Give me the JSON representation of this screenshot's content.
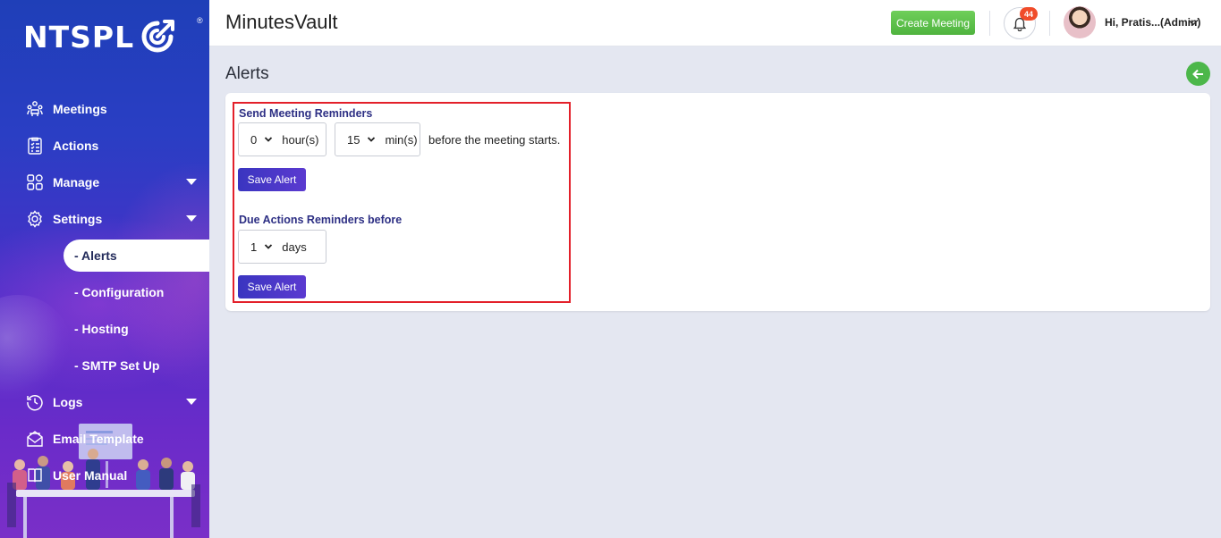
{
  "brand": {
    "logo_text": "NTSPL",
    "registered": "®"
  },
  "header": {
    "app_title": "MinutesVault",
    "create_button": "Create Meeting",
    "notification_count": "44",
    "user_label": "Hi, Pratis...(Admin)"
  },
  "sidebar": {
    "items": [
      {
        "label": "Meetings",
        "icon": "meetings-icon"
      },
      {
        "label": "Actions",
        "icon": "checklist-icon"
      },
      {
        "label": "Manage",
        "icon": "apps-icon"
      },
      {
        "label": "Settings",
        "icon": "gear-icon"
      },
      {
        "label": "Logs",
        "icon": "history-icon"
      },
      {
        "label": "Email Template",
        "icon": "envelope-icon"
      },
      {
        "label": "User Manual",
        "icon": "book-icon"
      }
    ],
    "settings_sub": [
      {
        "label": "- Alerts",
        "active": true
      },
      {
        "label": "- Configuration",
        "active": false
      },
      {
        "label": "- Hosting",
        "active": false
      },
      {
        "label": "- SMTP Set Up",
        "active": false
      }
    ]
  },
  "page": {
    "title": "Alerts",
    "meeting_reminders": {
      "label": "Send Meeting Reminders",
      "hours_value": "0",
      "hours_unit": "hour(s)",
      "mins_value": "15",
      "mins_unit": "min(s)",
      "suffix_text": "before the meeting starts.",
      "save_label": "Save Alert"
    },
    "action_reminders": {
      "label": "Due Actions Reminders before",
      "days_value": "1",
      "days_unit": "days",
      "save_label": "Save Alert"
    }
  },
  "colors": {
    "highlight_border": "#e3202a",
    "save_button": "#3a35c0",
    "create_button": "#5cbf48",
    "back_button": "#4cb74a",
    "badge": "#f04c2a"
  }
}
